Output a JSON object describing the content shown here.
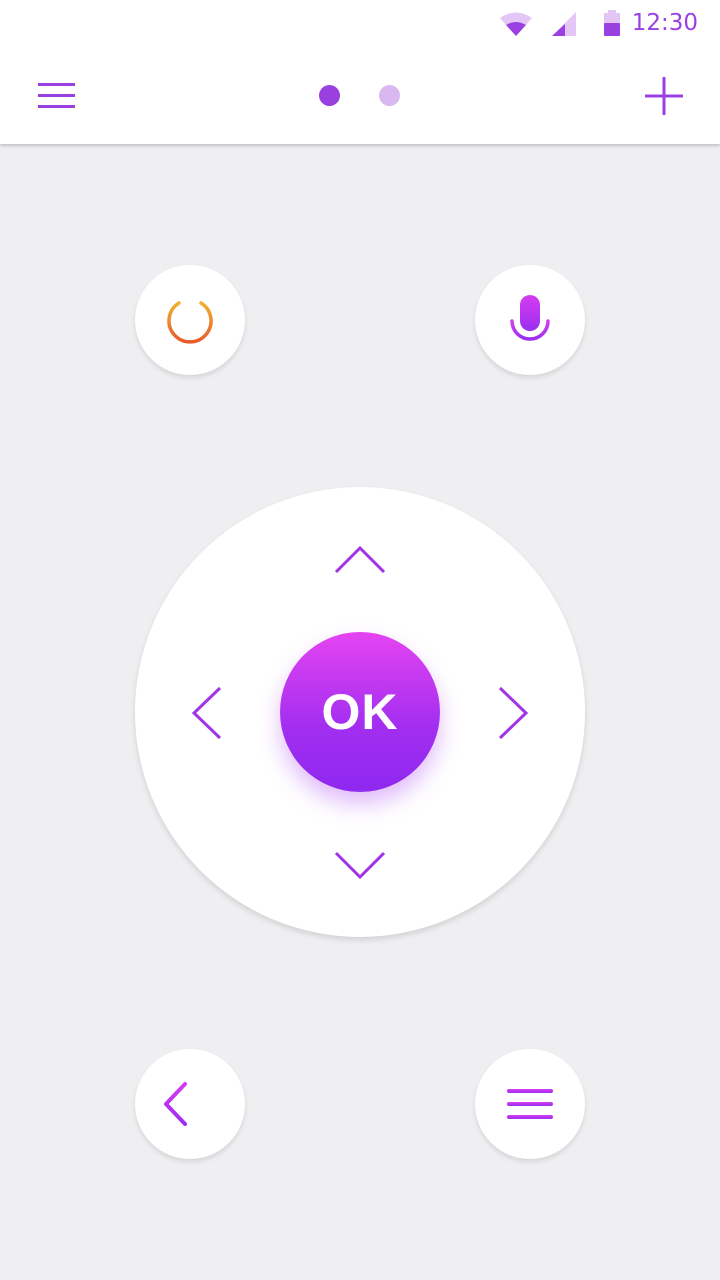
{
  "status_bar": {
    "time": "12:30",
    "icons": [
      "wifi-icon",
      "cellular-signal-icon",
      "battery-icon"
    ]
  },
  "toolbar": {
    "menu_icon": "hamburger-menu-icon",
    "page_indicator": {
      "count": 2,
      "active_index": 0
    },
    "add_icon": "plus-icon"
  },
  "remote": {
    "power_icon": "power-icon",
    "mic_icon": "microphone-icon",
    "ok_label": "OK",
    "dpad_icons": [
      "chevron-up-icon",
      "chevron-left-icon",
      "chevron-right-icon",
      "chevron-down-icon"
    ],
    "back_icon": "back-arrow-icon",
    "menu_icon": "menu-lines-icon"
  },
  "colors": {
    "accent": "#9a3fe0",
    "accent_light": "#d9b8f2",
    "power_gradient": [
      "#f0b030",
      "#e85a2a"
    ],
    "ok_gradient": [
      "#e544f2",
      "#8f28f0"
    ],
    "background": "#efeef0"
  }
}
